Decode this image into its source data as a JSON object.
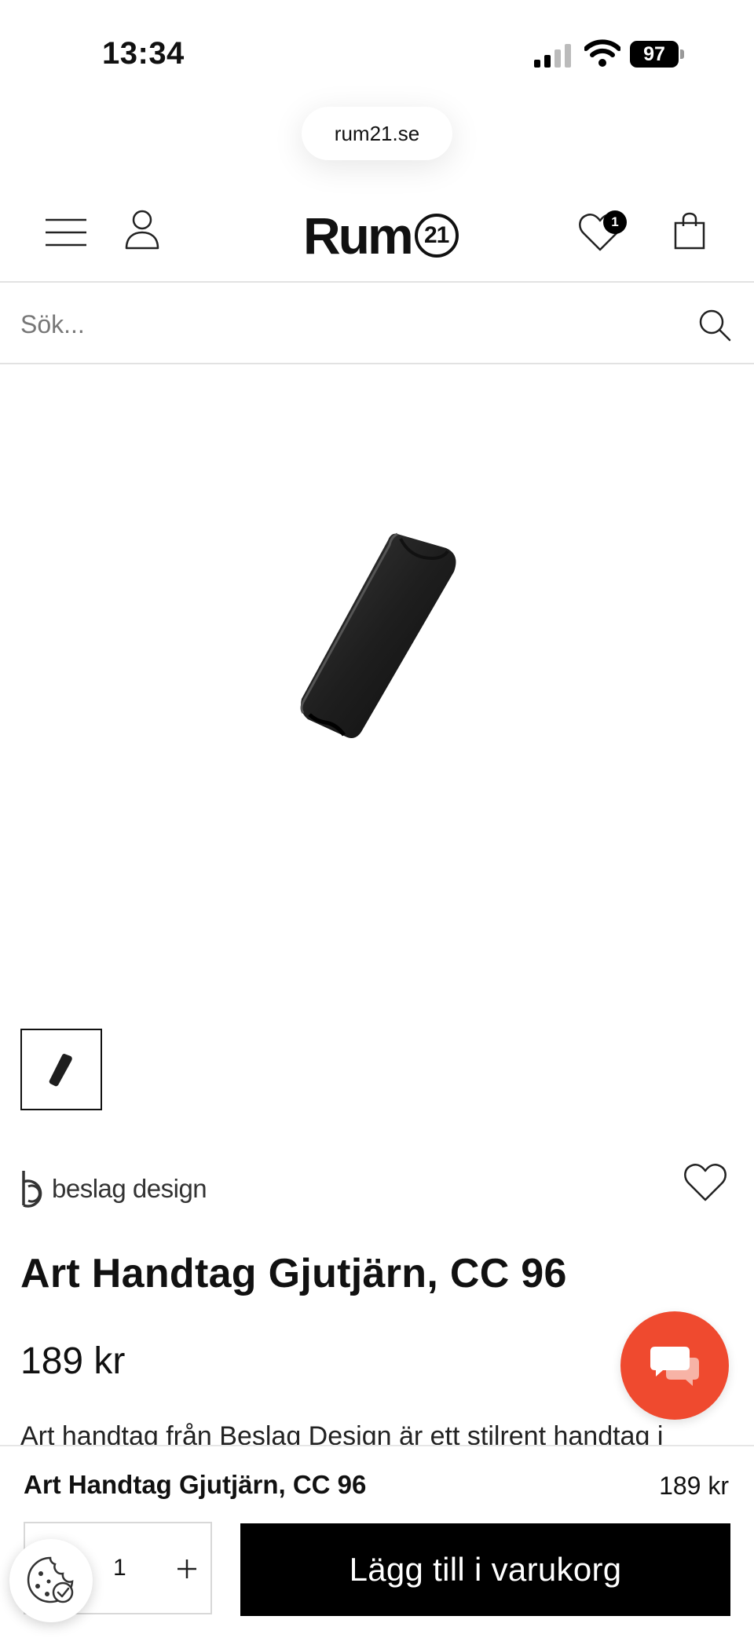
{
  "status_bar": {
    "time": "13:34",
    "battery": "97"
  },
  "browser": {
    "url": "rum21.se"
  },
  "header": {
    "logo_text": "Rum",
    "logo_number": "21",
    "wishlist_count": "1"
  },
  "search": {
    "placeholder": "Sök..."
  },
  "product": {
    "brand": "beslag design",
    "title": "Art Handtag Gjutjärn, CC 96",
    "price": "189 kr",
    "description_preview": "Art handtag från Beslag Design är ett stilrent handtag i"
  },
  "sticky_bar": {
    "title": "Art Handtag Gjutjärn, CC 96",
    "price": "189 kr",
    "quantity": "1",
    "add_to_cart_label": "Lägg till i varukorg"
  },
  "colors": {
    "chat_accent": "#ef4a2f",
    "button_bg": "#000000"
  }
}
